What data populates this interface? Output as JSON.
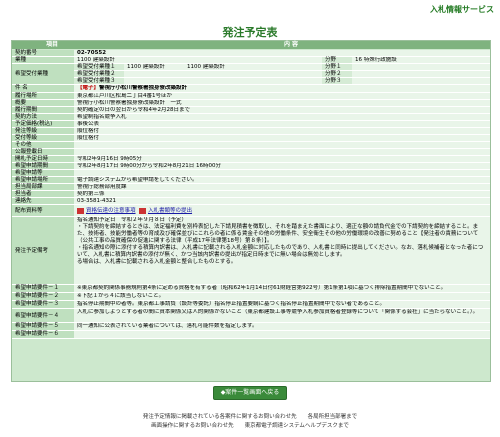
{
  "header": {
    "service_label": "入札情報サービス"
  },
  "page_title": "発注予定表",
  "table": {
    "col_item": "項目",
    "col_content": "内 容",
    "rows": {
      "contract_no": {
        "label": "契約番号",
        "value": "02-70552"
      },
      "business": {
        "label": "業種",
        "value": "1100 建築設計"
      },
      "bunya": {
        "label": "分野",
        "value": "16 特殊行政施設"
      },
      "kibou_label": "希望受付業種",
      "kibou1": {
        "label": "希望受付業種１",
        "value": "1100 建築設計",
        "value2": "1100 建築設計",
        "bunya": "分野１",
        "bunya_val": ""
      },
      "kibou2": {
        "label": "希望受付業種２",
        "value": "",
        "bunya": "分野２"
      },
      "kibou3": {
        "label": "希望受付業種３",
        "value": "",
        "bunya": "分野３"
      },
      "kenmei": {
        "label": "件 名",
        "badge": "【電子】",
        "value": "警視庁小松川警察署独身寮改築設計"
      },
      "place": {
        "label": "履行場所",
        "value": "東京都江戸川区松島二丁目4番1号ほか"
      },
      "summary": {
        "label": "概要",
        "value": "警視庁小松川警察署独身寮改築設計　一式"
      },
      "period": {
        "label": "履行期間",
        "value": "契約確定の日の翌日から令和4年2月28日まで"
      },
      "method": {
        "label": "契約方法",
        "value": "希望制指名競争入札"
      },
      "price": {
        "label": "予定価格(税込)",
        "value": "事後公表"
      },
      "timing": {
        "label": "発注等級",
        "value": "順位格付"
      },
      "kakuzuke": {
        "label": "受付等級",
        "value": "順位格付"
      },
      "other": {
        "label": "その他",
        "value": ""
      },
      "announce": {
        "label": "公報登載日",
        "value": ""
      },
      "open_date": {
        "label": "開札予定日時",
        "value": "令和2年9月16日 9時05分"
      },
      "apply_period": {
        "label": "希望申請期間",
        "value": "令和2年8月17日 9時00分から令和2年8月21日 16時00分"
      },
      "bid_notice": {
        "label": "希望申請等",
        "value": ""
      },
      "apply_place": {
        "label": "希望申請場所",
        "value": "電子調達システムから希望申請をしてください。"
      },
      "dept": {
        "label": "担当局部課",
        "value": "警視庁総務部用度課"
      },
      "person": {
        "label": "担当者",
        "value": "契約第三係"
      },
      "tel": {
        "label": "連絡先",
        "value": "03-3581-4321"
      },
      "docs": {
        "label": "配布資料等",
        "link1": "資格伝達の注意事項",
        "link2": "入札書類等の提出"
      },
      "notes_label": "発注予定備考",
      "notes": [
        "指名通知予定日　令和２年９月８日（予定）",
        "・下請契約を締結するときは、法定福利費を別枠表記した下請見積書を徴取し、それを踏まえた書面により、適正な額の請負代金での下請契約を締結すること。また、技術者、技能労働者等の育成及び確保並びにこれらの者に係る賃金その他の労働条件、安全衛生その他の労働環境の改善に努めること【発注者の責務について（公共工事の品質確保の促進に関する法律（平成17年法律第18号）第８条）】。",
        "・指名通知の際に添付する積算内訳書は、入札書に記載される入札金額に対応したものであり、入札書と同時に提出してください。なお、落札候補者となった者について、入札書に積算内訳書の添付が無く、かつ当該内訳書の提出が指定日時までに無い場合は無効とします。",
        "る場合は、入札書に記載される入札金額と整合したものとする。"
      ],
      "req1": {
        "label": "希望申請要件－１",
        "value": "※東京都契約関係事務規則第4条に定める資格を有する者（昭和62年1月14日付61財経営第922号）第1条第1項に基づく排除措置期間中でないこと。"
      },
      "req2": {
        "label": "希望申請要件－２",
        "value": "※下記１から４に該当しないこと。"
      },
      "req3": {
        "label": "希望申請要件－３",
        "value": "指名停止期間中の者等。東京都工事請負（設計等委託）指名停止措置要綱に基づく指名停止措置期間中でない者であること。"
      },
      "req4": {
        "label": "希望申請要件－４",
        "value": "入札に参加しようとする者の間に資本関係又は人的関係がないこと（東京都建設工事等競争入札参加資格者登録等について「関係する会社」に当たらないこと。）。"
      },
      "req5": {
        "label": "希望申請要件－５",
        "value": "同一通知に公表されている業者については、落札可能件数を指定します。"
      },
      "req6": {
        "label": "希望申請要件－６",
        "value": ""
      }
    }
  },
  "back_button": "◆案件一覧画面へ戻る",
  "footer": {
    "line1": "発注予定情報に掲載されている各案件に関するお問い合わせ先　　各局所担当部署まで",
    "line2": "画面操作に関するお問い合わせ先　　東京都電子調達システムヘルプデスクまで"
  }
}
